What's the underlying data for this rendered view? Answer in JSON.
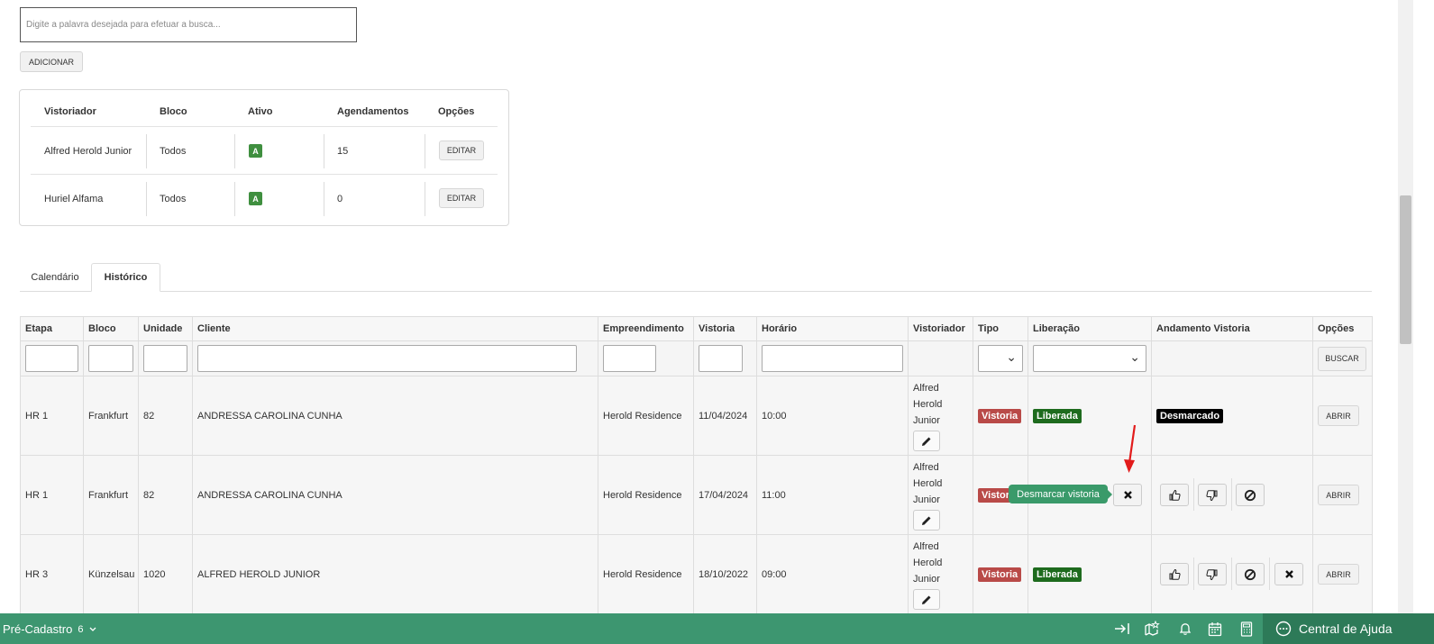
{
  "search": {
    "placeholder": "Digite a palavra desejada para efetuar a busca..."
  },
  "add_button": "ADICIONAR",
  "vistoriadores": {
    "headers": [
      "Vistoriador",
      "Bloco",
      "Ativo",
      "Agendamentos",
      "Opções"
    ],
    "rows": [
      {
        "name": "Alfred Herold Junior",
        "bloco": "Todos",
        "ativo": "A",
        "agendamentos": "15",
        "option": "EDITAR"
      },
      {
        "name": "Huriel Alfama",
        "bloco": "Todos",
        "ativo": "A",
        "agendamentos": "0",
        "option": "EDITAR"
      }
    ]
  },
  "tabs": [
    {
      "label": "Calendário",
      "active": false
    },
    {
      "label": "Histórico",
      "active": true
    }
  ],
  "history": {
    "headers": [
      "Etapa",
      "Bloco",
      "Unidade",
      "Cliente",
      "Empreendimento",
      "Vistoria",
      "Horário",
      "Vistoriador",
      "Tipo",
      "Liberação",
      "Andamento Vistoria",
      "Opções"
    ],
    "search_button": "BUSCAR",
    "rows": [
      {
        "etapa": "HR 1",
        "bloco": "Frankfurt",
        "unidade": "82",
        "cliente": "ANDRESSA CAROLINA CUNHA",
        "empreendimento": "Herold Residence",
        "vistoria": "11/04/2024",
        "horario": "10:00",
        "vistoriador": [
          "Alfred",
          "Herold",
          "Junior"
        ],
        "tipo": "Vistoria",
        "liberacao": "Liberada",
        "andamento": "Desmarcado",
        "option": "ABRIR"
      },
      {
        "etapa": "HR 1",
        "bloco": "Frankfurt",
        "unidade": "82",
        "cliente": "ANDRESSA CAROLINA CUNHA",
        "empreendimento": "Herold Residence",
        "vistoria": "17/04/2024",
        "horario": "11:00",
        "vistoriador": [
          "Alfred",
          "Herold",
          "Junior"
        ],
        "tipo": "Vistoria",
        "liberacao": "",
        "andamento": "",
        "option": "ABRIR"
      },
      {
        "etapa": "HR 3",
        "bloco": "Künzelsau",
        "unidade": "1020",
        "cliente": "ALFRED HEROLD JUNIOR",
        "empreendimento": "Herold Residence",
        "vistoria": "18/10/2022",
        "horario": "09:00",
        "vistoriador": [
          "Alfred",
          "Herold",
          "Junior"
        ],
        "tipo": "Vistoria",
        "liberacao": "Liberada",
        "andamento": "",
        "option": "ABRIR"
      }
    ]
  },
  "tooltip": "Desmarcar vistoria",
  "tipo_truncated": "Vistor",
  "bottom_bar": {
    "module": "Pré-Cadastro",
    "count": "6",
    "help_label": "Central de Ajuda"
  },
  "colors": {
    "bar_green": "#3d9670",
    "badge_green": "#3f8f3f",
    "tipo_red": "#b94a48",
    "liberada_green": "#1e6b1e",
    "tooltip_green": "#3a9a6a"
  }
}
